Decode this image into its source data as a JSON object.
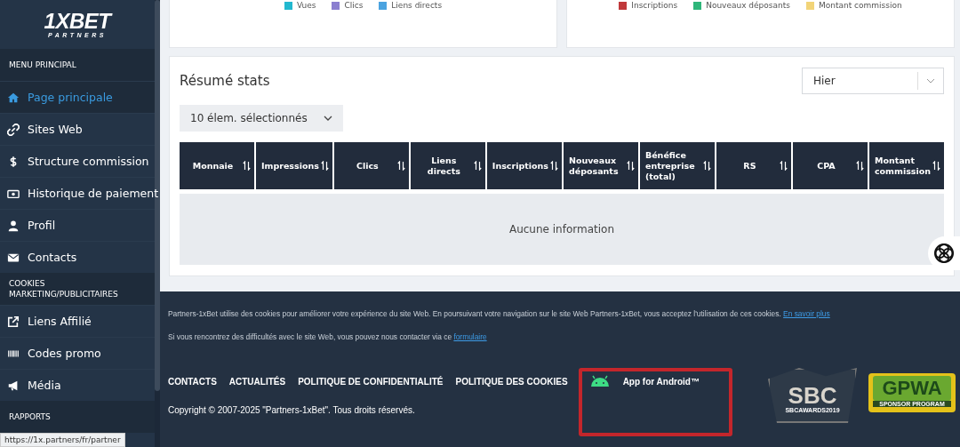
{
  "sidebar": {
    "logo": {
      "brand": "1XBET",
      "sub": "PARTNERS"
    },
    "sections": [
      {
        "title": "MENU PRINCIPAL",
        "items": [
          {
            "label": "Page principale",
            "selected": true
          },
          {
            "label": "Sites Web",
            "selected": false
          },
          {
            "label": "Structure commission",
            "selected": false
          },
          {
            "label": "Historique de paiement",
            "selected": false
          },
          {
            "label": "Profil",
            "selected": false
          },
          {
            "label": "Contacts",
            "selected": false
          }
        ]
      },
      {
        "title": "COOKIES MARKETING/PUBLICITAIRES",
        "items": [
          {
            "label": "Liens Affilié",
            "selected": false
          },
          {
            "label": "Codes promo",
            "selected": false
          },
          {
            "label": "Média",
            "selected": false
          }
        ]
      },
      {
        "title": "RAPPORTS"
      }
    ],
    "status_url": "https://1x.partners/fr/partner"
  },
  "top_charts": [
    {
      "legend": [
        {
          "label": "Vues",
          "color": "#22b8cf"
        },
        {
          "label": "Clics",
          "color": "#8b7fd0"
        },
        {
          "label": "Liens directs",
          "color": "#4ba3e0"
        }
      ]
    },
    {
      "legend": [
        {
          "label": "Inscriptions",
          "color": "#c0393b"
        },
        {
          "label": "Nouveaux déposants",
          "color": "#2eb67a"
        },
        {
          "label": "Montant commission",
          "color": "#f2d478"
        }
      ]
    }
  ],
  "stats": {
    "title": "Résumé stats",
    "period": {
      "value": "Hier"
    },
    "selection": {
      "value": "10 élem. sélectionnés"
    },
    "columns": [
      "Monnaie",
      "Impressions",
      "Clics",
      "Liens directs",
      "Inscriptions",
      "Nouveaux déposants",
      "Bénéfice entreprise (total)",
      "RS",
      "CPA",
      "Montant commission"
    ],
    "empty_text": "Aucune information"
  },
  "footer": {
    "cookie_notice": {
      "text": "Partners-1xBet utilise des cookies pour améliorer votre expérience du site Web. En poursuivant votre navigation sur le site Web Partners-1xBet, vous acceptez l'utilisation de ces cookies.",
      "link": "En savoir plus"
    },
    "contact_notice": {
      "text": "Si vous rencontrez des difficultés avec le site Web, vous pouvez nous contacter via ce",
      "link": "formulaire"
    },
    "links": [
      "CONTACTS",
      "ACTUALITÉS",
      "POLITIQUE DE CONFIDENTIALITÉ",
      "POLITIQUE DES COOKIES"
    ],
    "app": {
      "label": "App for Android™",
      "highlighted": true
    },
    "copyright": "Copyright © 2007-2025 \"Partners-1xBet\". Tous droits réservés.",
    "badges": {
      "sbc": {
        "mark": "SBC",
        "caption": "SBCAWARDS2019"
      },
      "gpwa": {
        "mark": "GPWA",
        "caption": "SPONSOR PROGRAM"
      }
    }
  }
}
